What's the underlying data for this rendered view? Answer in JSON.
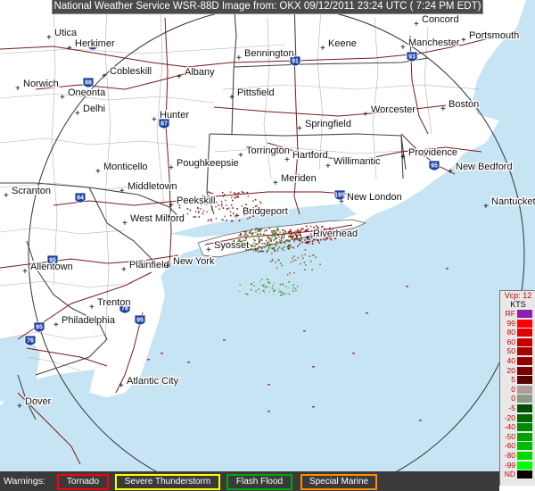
{
  "header": {
    "title": "National Weather Service WSR-88D Image from:  OKX  09/12/2011  23:24 UTC  ( 7:24 PM EDT)"
  },
  "cities": [
    {
      "name": "Concord"
    },
    {
      "name": "Utica"
    },
    {
      "name": "Herkimer"
    },
    {
      "name": "Portsmouth"
    },
    {
      "name": "Manchester"
    },
    {
      "name": "Keene"
    },
    {
      "name": "Bennington"
    },
    {
      "name": "Cobleskill"
    },
    {
      "name": "Albany"
    },
    {
      "name": "Norwich"
    },
    {
      "name": "Oneonta"
    },
    {
      "name": "Pittsfield"
    },
    {
      "name": "Delhi"
    },
    {
      "name": "Worcester"
    },
    {
      "name": "Boston"
    },
    {
      "name": "Hunter"
    },
    {
      "name": "Springfield"
    },
    {
      "name": "Torrington"
    },
    {
      "name": "Hartford"
    },
    {
      "name": "Willimantic"
    },
    {
      "name": "Providence"
    },
    {
      "name": "Monticello"
    },
    {
      "name": "Poughkeepsie"
    },
    {
      "name": "New Bedford"
    },
    {
      "name": "Middletown"
    },
    {
      "name": "Meriden"
    },
    {
      "name": "Scranton"
    },
    {
      "name": "Peekskill"
    },
    {
      "name": "New London"
    },
    {
      "name": "Nantucket"
    },
    {
      "name": "Bridgeport"
    },
    {
      "name": "West Milford"
    },
    {
      "name": "Riverhead"
    },
    {
      "name": "Syosset"
    },
    {
      "name": "Allentown"
    },
    {
      "name": "Plainfield"
    },
    {
      "name": "New York"
    },
    {
      "name": "Trenton"
    },
    {
      "name": "Philadelphia"
    },
    {
      "name": "Atlantic City"
    },
    {
      "name": "Dover"
    }
  ],
  "highways": [
    "90",
    "88",
    "91",
    "93",
    "87",
    "84",
    "95",
    "195",
    "95",
    "78",
    "95",
    "76",
    "95"
  ],
  "legend": {
    "header": "Vcp: 12",
    "units": "KTS",
    "rows": [
      {
        "label": "RF",
        "color": "#8a1fb0"
      },
      {
        "label": "99",
        "color": "#ff0000"
      },
      {
        "label": "80",
        "color": "#e00000"
      },
      {
        "label": "60",
        "color": "#c40000"
      },
      {
        "label": "50",
        "color": "#a80000"
      },
      {
        "label": "40",
        "color": "#900000"
      },
      {
        "label": "20",
        "color": "#780000"
      },
      {
        "label": "5",
        "color": "#5a0000"
      },
      {
        "label": "0",
        "color": "#b09a9a"
      },
      {
        "label": "0",
        "color": "#8c9a8c"
      },
      {
        "label": "-5",
        "color": "#004f00"
      },
      {
        "label": "-20",
        "color": "#006600"
      },
      {
        "label": "-40",
        "color": "#008a00"
      },
      {
        "label": "-50",
        "color": "#00a000"
      },
      {
        "label": "-60",
        "color": "#00bb00"
      },
      {
        "label": "-80",
        "color": "#00d800"
      },
      {
        "label": "-99",
        "color": "#00ff00"
      },
      {
        "label": "ND",
        "color": "#000000"
      }
    ]
  },
  "warnings": {
    "label": "Warnings:",
    "items": [
      {
        "label": "Tornado",
        "color": "#ff0000"
      },
      {
        "label": "Severe Thunderstorm",
        "color": "#ffff00"
      },
      {
        "label": "Flash Flood",
        "color": "#00aa00"
      },
      {
        "label": "Special Marine",
        "color": "#ff8c00"
      }
    ]
  },
  "colors": {
    "ocean": "#c7e4f5",
    "land": "#ffffff",
    "state_border": "#444444",
    "county_border": "#b0b0b0",
    "road": "#7a1a1a",
    "range_ring": "#333333"
  }
}
